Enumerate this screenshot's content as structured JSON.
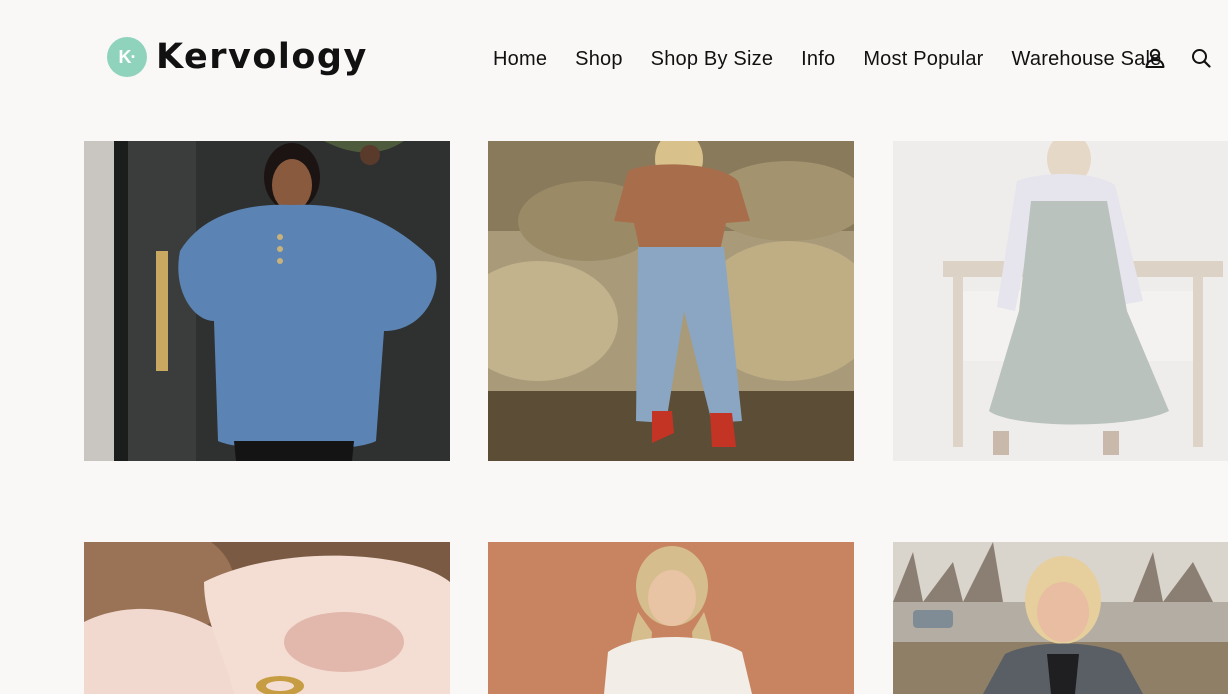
{
  "brand": {
    "mark": "K·",
    "name": "Kervology",
    "mark_color": "#8fd3bd"
  },
  "nav": {
    "items": [
      {
        "label": "Home"
      },
      {
        "label": "Shop"
      },
      {
        "label": "Shop By Size"
      },
      {
        "label": "Info"
      },
      {
        "label": "Most Popular"
      },
      {
        "label": "Warehouse Sale"
      }
    ],
    "icons": [
      "account-icon",
      "search-icon"
    ]
  },
  "products": [
    {
      "photo": "woman-blue-henley-top-at-door"
    },
    {
      "photo": "woman-tan-top-jeans-red-boots-desert"
    },
    {
      "photo": "woman-sage-pinafore-dress-bedroom"
    },
    {
      "photo": "hands-holding-gold-ring"
    },
    {
      "photo": "woman-white-blouse-terracotta-wall"
    },
    {
      "photo": "woman-grey-cardigan-outdoors"
    }
  ]
}
